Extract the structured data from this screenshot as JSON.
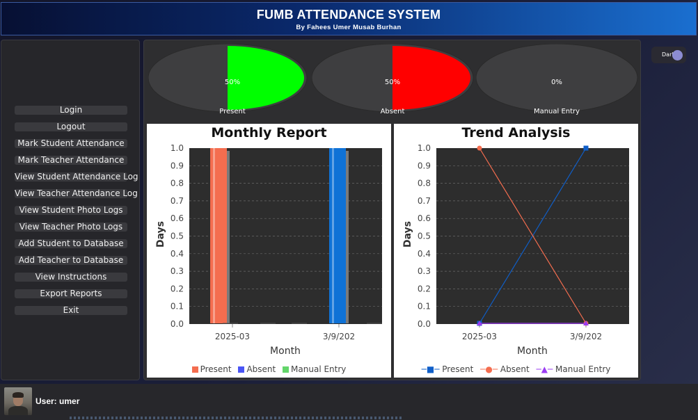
{
  "header": {
    "title": "FUMB ATTENDANCE SYSTEM",
    "subtitle": "By Fahees Umer Musab Burhan",
    "gradient": [
      "#071033",
      "#1a6fd0"
    ]
  },
  "sidebar": {
    "items": [
      {
        "label": "Login"
      },
      {
        "label": "Logout"
      },
      {
        "label": "Mark Student Attendance"
      },
      {
        "label": "Mark Teacher Attendance"
      },
      {
        "label": "View Student Attendance Log"
      },
      {
        "label": "View Teacher Attendance Log"
      },
      {
        "label": "View Student Photo Logs"
      },
      {
        "label": "View Teacher Photo Logs"
      },
      {
        "label": "Add Student to Database"
      },
      {
        "label": "Add Teacher to Database"
      },
      {
        "label": "View Instructions"
      },
      {
        "label": "Export Reports"
      },
      {
        "label": "Exit"
      }
    ]
  },
  "theme_toggle": {
    "label": "Dark",
    "state": "on"
  },
  "summary": [
    {
      "label": "Present",
      "percent_text": "50%",
      "fraction": 0.5,
      "color": "#00ff00"
    },
    {
      "label": "Absent",
      "percent_text": "50%",
      "fraction": 0.5,
      "color": "#ff0000"
    },
    {
      "label": "Manual Entry",
      "percent_text": "0%",
      "fraction": 0.0,
      "color": "#ffffff"
    }
  ],
  "monthly_report": {
    "title": "Monthly Report",
    "ylabel": "Days",
    "xlabel": "Month",
    "legend": [
      {
        "name": "Present",
        "color": "#f46d4f"
      },
      {
        "name": "Absent",
        "color": "#4a55f5"
      },
      {
        "name": "Manual Entry",
        "color": "#63d56a"
      }
    ]
  },
  "trend_analysis": {
    "title": "Trend Analysis",
    "ylabel": "Days",
    "xlabel": "Month",
    "legend": [
      {
        "name": "Present",
        "color": "#0f5ec8",
        "marker": "■"
      },
      {
        "name": "Absent",
        "color": "#f46d4f",
        "marker": "●"
      },
      {
        "name": "Manual Entry",
        "color": "#9b3df2",
        "marker": "▲"
      }
    ]
  },
  "chart_data": [
    {
      "type": "bar",
      "title": "Monthly Report",
      "xlabel": "Month",
      "ylabel": "Days",
      "categories": [
        "2025-03",
        "3/9/202"
      ],
      "ylim": [
        0,
        1.0
      ],
      "yticks": [
        "0.0",
        "0.1",
        "0.2",
        "0.3",
        "0.4",
        "0.5",
        "0.6",
        "0.7",
        "0.8",
        "0.9",
        "1.0"
      ],
      "series": [
        {
          "name": "Present",
          "values": [
            1.0,
            0.0
          ],
          "color": "#f46d4f"
        },
        {
          "name": "Absent",
          "values": [
            0.0,
            1.0
          ],
          "color": "#0f72d6"
        },
        {
          "name": "Manual Entry",
          "values": [
            0.0,
            0.0
          ],
          "color": "#63d56a"
        }
      ],
      "grid": true,
      "legend_position": "bottom"
    },
    {
      "type": "line",
      "title": "Trend Analysis",
      "xlabel": "Month",
      "ylabel": "Days",
      "categories": [
        "2025-03",
        "3/9/202"
      ],
      "ylim": [
        0,
        1.0
      ],
      "yticks": [
        "0.0",
        "0.1",
        "0.2",
        "0.3",
        "0.4",
        "0.5",
        "0.6",
        "0.7",
        "0.8",
        "0.9",
        "1.0"
      ],
      "series": [
        {
          "name": "Present",
          "values": [
            0.0,
            1.0
          ],
          "color": "#0f5ec8",
          "marker": "square"
        },
        {
          "name": "Absent",
          "values": [
            1.0,
            0.0
          ],
          "color": "#f46d4f",
          "marker": "circle"
        },
        {
          "name": "Manual Entry",
          "values": [
            0.0,
            0.0
          ],
          "color": "#9b3df2",
          "marker": "triangle"
        }
      ],
      "grid": true,
      "legend_position": "bottom"
    }
  ],
  "user": {
    "label": "User: umer"
  }
}
